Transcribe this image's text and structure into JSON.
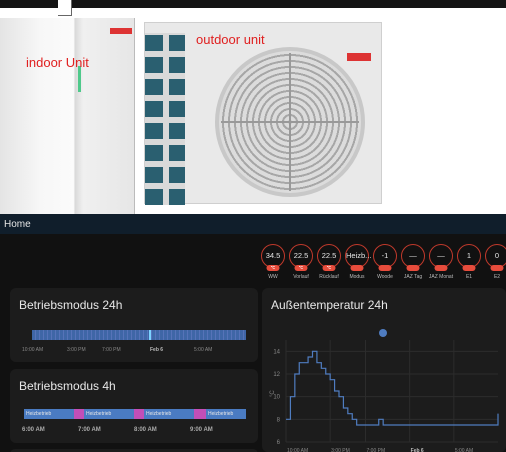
{
  "photo": {
    "indoor_label": "indoor Unit",
    "outdoor_label": "outdoor unit",
    "brand_color": "#d33333"
  },
  "header": {
    "title": "Home",
    "background": "#101e2b"
  },
  "sensors": [
    {
      "value": "34.5",
      "label": "WW",
      "icon": "thermometer-icon"
    },
    {
      "value": "22.5",
      "label": "Vorlauf",
      "icon": "thermometer-icon"
    },
    {
      "value": "22.5",
      "label": "Rücklauf",
      "icon": "thermometer-icon"
    },
    {
      "value": "Heizb...",
      "label": "Modus",
      "icon": ""
    },
    {
      "value": "-1",
      "label": "Woode",
      "icon": ""
    },
    {
      "value": "—",
      "label": "JAZ Tag",
      "icon": ""
    },
    {
      "value": "—",
      "label": "JAZ Monat",
      "icon": ""
    },
    {
      "value": "1",
      "label": "E1",
      "icon": ""
    },
    {
      "value": "0",
      "label": "E2",
      "icon": ""
    }
  ],
  "mode24": {
    "title": "Betriebsmodus 24h",
    "ticks": [
      {
        "label": "10:00 AM",
        "bold": false
      },
      {
        "label": "3:00 PM",
        "bold": false
      },
      {
        "label": "7:00 PM",
        "bold": false
      },
      {
        "label": "Feb 6",
        "bold": true
      },
      {
        "label": "5:00 AM",
        "bold": false
      }
    ],
    "color": "#3f66a6"
  },
  "mode4": {
    "title": "Betriebsmodus 4h",
    "segments": [
      {
        "label": "Heizbetrieb",
        "state": "heat"
      },
      {
        "label": "",
        "state": "other"
      },
      {
        "label": "Heizbetrieb",
        "state": "heat"
      },
      {
        "label": "",
        "state": "other"
      },
      {
        "label": "Heizbetrieb",
        "state": "heat"
      },
      {
        "label": "",
        "state": "other"
      },
      {
        "label": "Heizbetrieb",
        "state": "heat"
      }
    ],
    "ticks": [
      "6:00 AM",
      "7:00 AM",
      "8:00 AM",
      "9:00 AM"
    ],
    "colors": {
      "heat": "#4a7bc2",
      "other": "#c24fb7"
    }
  },
  "chart_data": {
    "type": "line",
    "title": "Außentemperatur 24h",
    "ylabel": "°C",
    "xlabel": "",
    "ylim": [
      6,
      15
    ],
    "yticks": [
      6,
      8,
      10,
      12,
      14
    ],
    "xticks": [
      {
        "label": "10:00 AM",
        "bold": false
      },
      {
        "label": "3:00 PM",
        "bold": false
      },
      {
        "label": "7:00 PM",
        "bold": false
      },
      {
        "label": "Feb 6",
        "bold": true
      },
      {
        "label": "5:00 AM",
        "bold": false
      }
    ],
    "grid": true,
    "color": "#4f7cc0",
    "series": [
      {
        "x": [
          0,
          0.5,
          1,
          1.5,
          2,
          2.5,
          3,
          3.5,
          4,
          4.5,
          5,
          5.5,
          6,
          6.5,
          7,
          7.5,
          8,
          8.5,
          9,
          9.5,
          10,
          10.5,
          11,
          11.5,
          12,
          12.5,
          13,
          13.5,
          14,
          14.5,
          15,
          15.5,
          16,
          16.5,
          17,
          17.5,
          18,
          18.5,
          19,
          19.5,
          20,
          20.5,
          21,
          21.5,
          22,
          22.5,
          23,
          23.5,
          24
        ],
        "y": [
          8,
          10,
          12,
          13,
          13,
          13.5,
          14,
          13,
          12.5,
          12,
          11.5,
          10.5,
          10,
          9,
          8.5,
          8,
          7.5,
          7.5,
          7.5,
          7.5,
          7.5,
          8,
          7.5,
          7.5,
          7.5,
          7.5,
          7.5,
          7.5,
          7.5,
          7.5,
          7.5,
          7.5,
          7.5,
          7.5,
          7.5,
          7.5,
          7.5,
          7.5,
          7.5,
          7.5,
          7.5,
          7.5,
          7.5,
          7.5,
          7.5,
          7.5,
          7.5,
          7.5,
          8.5
        ]
      }
    ]
  }
}
